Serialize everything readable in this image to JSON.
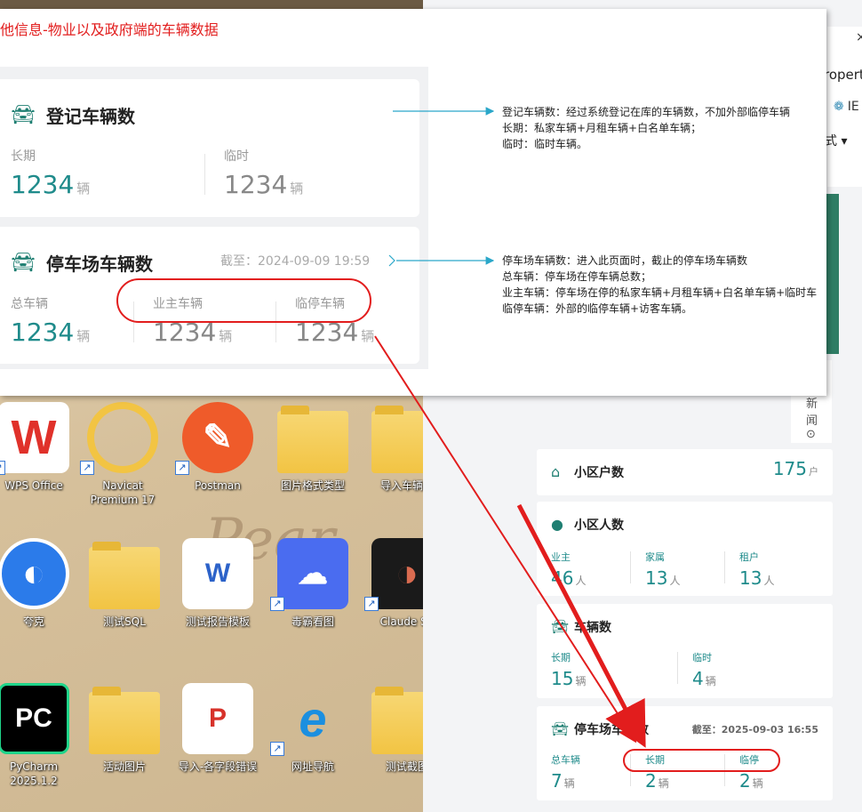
{
  "overlay": {
    "title": "他信息-物业以及政府端的车辆数据",
    "registered_card": {
      "title": "登记车辆数",
      "cols": [
        {
          "label": "长期",
          "value": "1234",
          "unit": "辆"
        },
        {
          "label": "临时",
          "value": "1234",
          "unit": "辆"
        }
      ]
    },
    "parking_card": {
      "title": "停车场车辆数",
      "cutoff": "截至：2024-09-09 19:59",
      "cols": [
        {
          "label": "总车辆",
          "value": "1234",
          "unit": "辆"
        },
        {
          "label": "业主车辆",
          "value": "1234",
          "unit": "辆"
        },
        {
          "label": "临停车辆",
          "value": "1234",
          "unit": "辆"
        }
      ]
    },
    "notes_registered": [
      "登记车辆数：经过系统登记在库的车辆数，不加外部临停车辆",
      "长期：私家车辆+月租车辆+白名单车辆；",
      "临时：临时车辆。"
    ],
    "notes_parking": [
      "停车场车辆数：进入此页面时，截止的停车场车辆数",
      "总车辆：停车场在停车辆总数；",
      "业主车辆：停车场在停的私家车辆+月租车辆+白名单车辆+临时车",
      "临停车辆：外部的临停车辆+访客车辆。"
    ]
  },
  "desktop": {
    "icons": [
      {
        "label": "WPS Office",
        "glyph": "W"
      },
      {
        "label": "Navicat Premium 17",
        "glyph": ""
      },
      {
        "label": "Postman",
        "glyph": "✎"
      },
      {
        "label": "图片格式类型",
        "glyph": ""
      },
      {
        "label": "导入车辆测",
        "glyph": ""
      },
      {
        "label": "夸克",
        "glyph": "◐"
      },
      {
        "label": "测试SQL",
        "glyph": ""
      },
      {
        "label": "测试报告模板",
        "glyph": "W"
      },
      {
        "label": "毒霸看图",
        "glyph": "☁"
      },
      {
        "label": "Claude Su",
        "glyph": "◑"
      },
      {
        "label": "PyCharm 2025.1.2",
        "glyph": "PC"
      },
      {
        "label": "活动图片",
        "glyph": ""
      },
      {
        "label": "导入-各字段错误",
        "glyph": "P"
      },
      {
        "label": "网址导航",
        "glyph": "e"
      },
      {
        "label": "测试截图",
        "glyph": ""
      }
    ],
    "shortcut_glyph": "↗"
  },
  "dashboard": {
    "close": "×",
    "property_text": "ropert",
    "ie_text": "IE",
    "style_text": "式 ▾",
    "news": [
      "新",
      "闻",
      "⊙"
    ],
    "households": {
      "title": "小区户数",
      "value": "175",
      "unit": "户"
    },
    "residents": {
      "title": "小区人数",
      "cols": [
        {
          "label": "业主",
          "value": "46",
          "unit": "人"
        },
        {
          "label": "家属",
          "value": "13",
          "unit": "人"
        },
        {
          "label": "租户",
          "value": "13",
          "unit": "人"
        }
      ]
    },
    "vehicles": {
      "title": "车辆数",
      "cols": [
        {
          "label": "长期",
          "value": "15",
          "unit": "辆"
        },
        {
          "label": "临时",
          "value": "4",
          "unit": "辆"
        }
      ]
    },
    "parking": {
      "title": "停车场车辆数",
      "cutoff": "截至：2025-09-03 16:55",
      "cols": [
        {
          "label": "总车辆",
          "value": "7",
          "unit": "辆"
        },
        {
          "label": "长期",
          "value": "2",
          "unit": "辆"
        },
        {
          "label": "临停",
          "value": "2",
          "unit": "辆"
        }
      ]
    }
  },
  "colors": {
    "teal": "#1f8b8b",
    "red_annotation": "#e21d1d",
    "arrow_blue": "#2aa7c9"
  }
}
